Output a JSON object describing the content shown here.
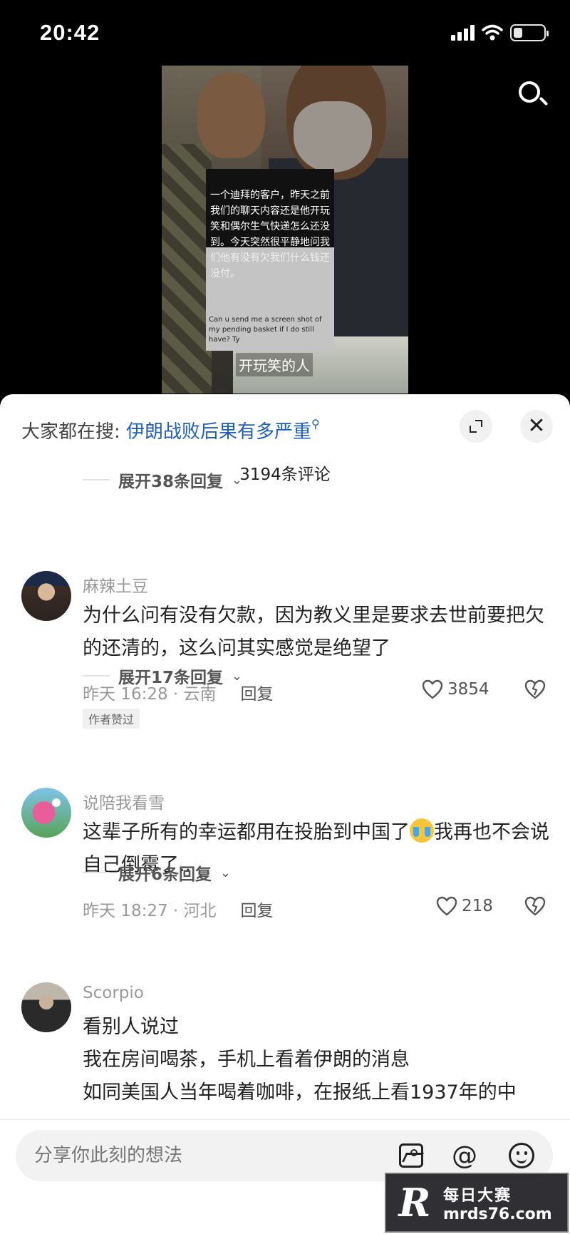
{
  "status_bar": {
    "time": "20:42"
  },
  "video": {
    "overlay_text": "一个迪拜的客户，昨天之前我们的聊天内容还是他开玩笑和偶尔生气快递怎么还没到。今天突然很平静地问我们他有没有欠我们什么钱还没付。",
    "overlay_en": "Can u send me a screen shot of my pending basket if I do still have? Ty",
    "subtitle": "开玩笑的人"
  },
  "comments_panel": {
    "hot_search_label": "大家都在搜:",
    "hot_search_query": "伊朗战败后果有多严重",
    "comment_count": "3194条评论",
    "expand_top": "展开38条回复"
  },
  "comments": [
    {
      "user": "麻辣土豆",
      "text": "为什么问有没有欠款，因为教义里是要求去世前要把欠的还清的，这么问其实感觉是绝望了",
      "time_loc": "昨天 16:28 · 云南",
      "reply": "回复",
      "likes": "3854",
      "badge": "作者赞过",
      "expand": "展开17条回复"
    },
    {
      "user": "说陪我看雪",
      "text_a": "这辈子所有的幸运都用在投胎到中国了",
      "text_b": "我再也不会说自己倒霉了..",
      "time_loc": "昨天 18:27 · 河北",
      "reply": "回复",
      "likes": "218",
      "expand": "展开6条回复"
    },
    {
      "user": "Scorpio",
      "lines": [
        "看别人说过",
        "我在房间喝茶，手机上看着伊朗的消息",
        "如同美国人当年喝着咖啡，在报纸上看1937年的中"
      ]
    }
  ],
  "input": {
    "placeholder": "分享你此刻的想法"
  },
  "watermark": {
    "title": "每日大赛",
    "url": "mrds76.com",
    "logo": "R"
  },
  "icons": [
    "signal-icon",
    "wifi-icon",
    "battery-icon",
    "search-icon",
    "expand-icon",
    "close-icon",
    "heart-icon",
    "dislike-icon",
    "image-icon",
    "at-icon",
    "emoji-icon",
    "chevron-down-icon"
  ]
}
